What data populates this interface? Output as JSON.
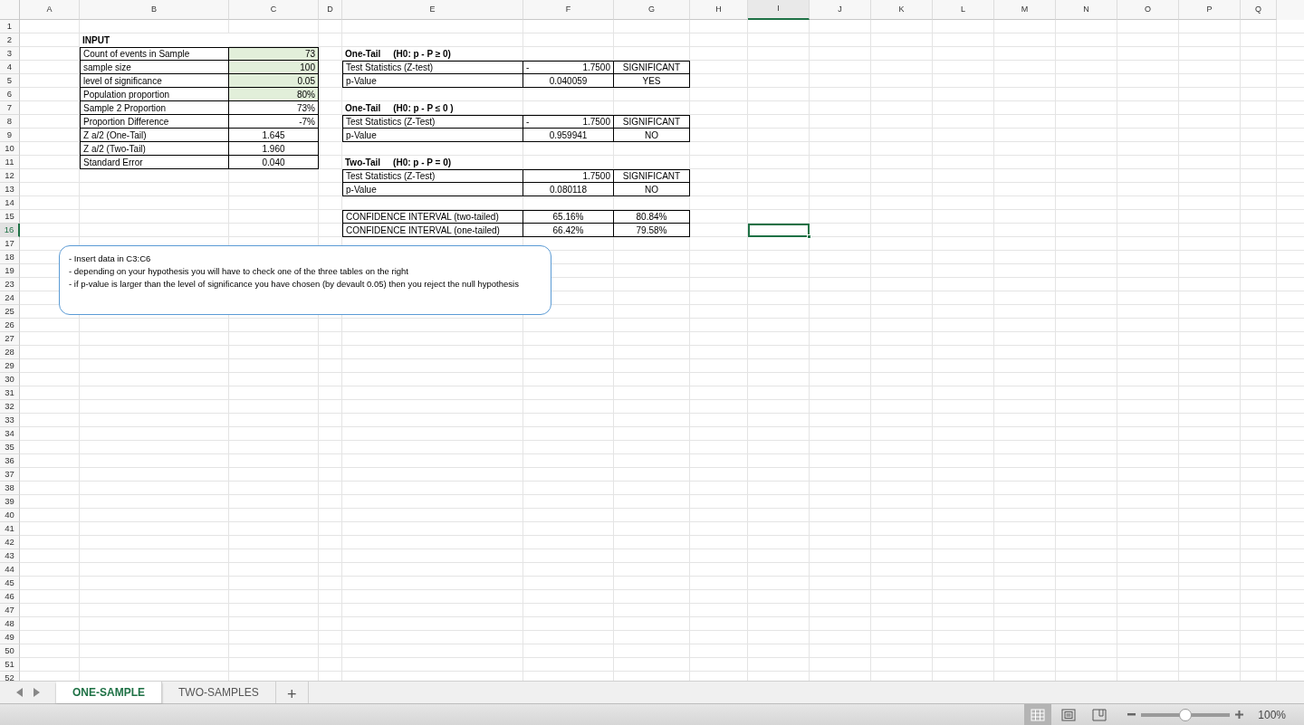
{
  "columns": [
    {
      "label": "A",
      "selected": false
    },
    {
      "label": "B",
      "selected": false
    },
    {
      "label": "C",
      "selected": false
    },
    {
      "label": "D",
      "selected": false
    },
    {
      "label": "E",
      "selected": false
    },
    {
      "label": "F",
      "selected": false
    },
    {
      "label": "G",
      "selected": false
    },
    {
      "label": "H",
      "selected": false
    },
    {
      "label": "I",
      "selected": true
    },
    {
      "label": "J",
      "selected": false
    },
    {
      "label": "K",
      "selected": false
    },
    {
      "label": "L",
      "selected": false
    },
    {
      "label": "M",
      "selected": false
    },
    {
      "label": "N",
      "selected": false
    },
    {
      "label": "O",
      "selected": false
    },
    {
      "label": "P",
      "selected": false
    },
    {
      "label": "Q",
      "selected": false
    }
  ],
  "rows": [
    {
      "label": "1",
      "selected": false
    },
    {
      "label": "2",
      "selected": false
    },
    {
      "label": "3",
      "selected": false
    },
    {
      "label": "4",
      "selected": false
    },
    {
      "label": "5",
      "selected": false
    },
    {
      "label": "6",
      "selected": false
    },
    {
      "label": "7",
      "selected": false
    },
    {
      "label": "8",
      "selected": false
    },
    {
      "label": "9",
      "selected": false
    },
    {
      "label": "10",
      "selected": false
    },
    {
      "label": "11",
      "selected": false
    },
    {
      "label": "12",
      "selected": false
    },
    {
      "label": "13",
      "selected": false
    },
    {
      "label": "14",
      "selected": false
    },
    {
      "label": "15",
      "selected": false
    },
    {
      "label": "16",
      "selected": true
    },
    {
      "label": "17",
      "selected": false
    },
    {
      "label": "18",
      "selected": false
    },
    {
      "label": "19",
      "selected": false
    },
    {
      "label": "23",
      "selected": false
    },
    {
      "label": "24",
      "selected": false
    },
    {
      "label": "25",
      "selected": false
    },
    {
      "label": "26",
      "selected": false
    },
    {
      "label": "27",
      "selected": false
    },
    {
      "label": "28",
      "selected": false
    },
    {
      "label": "29",
      "selected": false
    },
    {
      "label": "30",
      "selected": false
    },
    {
      "label": "31",
      "selected": false
    },
    {
      "label": "32",
      "selected": false
    },
    {
      "label": "33",
      "selected": false
    },
    {
      "label": "34",
      "selected": false
    },
    {
      "label": "35",
      "selected": false
    },
    {
      "label": "36",
      "selected": false
    },
    {
      "label": "37",
      "selected": false
    },
    {
      "label": "38",
      "selected": false
    },
    {
      "label": "39",
      "selected": false
    },
    {
      "label": "40",
      "selected": false
    },
    {
      "label": "41",
      "selected": false
    },
    {
      "label": "42",
      "selected": false
    },
    {
      "label": "43",
      "selected": false
    },
    {
      "label": "44",
      "selected": false
    },
    {
      "label": "45",
      "selected": false
    },
    {
      "label": "46",
      "selected": false
    },
    {
      "label": "47",
      "selected": false
    },
    {
      "label": "48",
      "selected": false
    },
    {
      "label": "49",
      "selected": false
    },
    {
      "label": "50",
      "selected": false
    },
    {
      "label": "51",
      "selected": false
    },
    {
      "label": "52",
      "selected": false
    }
  ],
  "input_table": {
    "title": "INPUT",
    "rows": [
      {
        "label": "Count of events in Sample",
        "value": "73",
        "kind": "input"
      },
      {
        "label": "sample size",
        "value": "100",
        "kind": "input"
      },
      {
        "label": "level of significance",
        "value": "0.05",
        "kind": "input"
      },
      {
        "label": "Population proportion",
        "value": "80%",
        "kind": "input"
      },
      {
        "label": "Sample 2 Proportion",
        "value": "73%",
        "kind": "computed"
      },
      {
        "label": "Proportion Difference",
        "value": "-7%",
        "kind": "computed"
      },
      {
        "label": "Z a/2 (One-Tail)",
        "value": "1.645",
        "kind": "critical"
      },
      {
        "label": "Z a/2 (Two-Tail)",
        "value": "1.960",
        "kind": "critical"
      },
      {
        "label": "Standard Error",
        "value": "0.040",
        "kind": "critical"
      }
    ]
  },
  "tests": [
    {
      "title": "One-Tail",
      "hypothesis": "(H0:  p - P ≥ 0)",
      "rows": [
        {
          "kind": "statistic",
          "label": "Test Statistics (Z-test)",
          "sign": "-",
          "value": "1.7500",
          "result": "SIGNIFICANT"
        },
        {
          "kind": "p_value",
          "label": "p-Value",
          "value": "0.040059",
          "result": "YES"
        }
      ]
    },
    {
      "title": "One-Tail",
      "hypothesis": "(H0:  p - P  ≤ 0 )",
      "rows": [
        {
          "kind": "statistic",
          "label": "Test Statistics (Z-Test)",
          "sign": "-",
          "value": "1.7500",
          "result": "SIGNIFICANT"
        },
        {
          "kind": "p_value",
          "label": "p-Value",
          "value": "0.959941",
          "result": "NO"
        }
      ]
    },
    {
      "title": "Two-Tail",
      "hypothesis": "(H0: p - P = 0)",
      "rows": [
        {
          "kind": "statistic",
          "label": "Test Statistics (Z-Test)",
          "value": "1.7500",
          "result": "SIGNIFICANT"
        },
        {
          "kind": "p_value",
          "label": "p-Value",
          "value": "0.080118",
          "result": "NO"
        }
      ]
    }
  ],
  "confidence_intervals": [
    {
      "label": "CONFIDENCE INTERVAL (two-tailed)",
      "lower": "65.16%",
      "upper": "80.84%"
    },
    {
      "label": "CONFIDENCE INTERVAL (one-tailed)",
      "lower": "66.42%",
      "upper": "79.58%"
    }
  ],
  "note": [
    "- Insert data in C3:C6",
    "- depending on your hypothesis you will have to check one of the three tables on the right",
    "- if p-value is larger than the level of significance you have chosen (by devault 0.05) then you reject the null hypothesis"
  ],
  "sheet_tabs": [
    {
      "label": "ONE-SAMPLE",
      "selected": true
    },
    {
      "label": "TWO-SAMPLES",
      "selected": false
    }
  ],
  "add_sheet": "+",
  "view_modes": [
    {
      "kind": "normal",
      "selected": true
    },
    {
      "kind": "page_layout",
      "selected": false
    },
    {
      "kind": "page_break",
      "selected": false
    }
  ],
  "zoom": {
    "level": 0.5,
    "reading": "100%"
  }
}
